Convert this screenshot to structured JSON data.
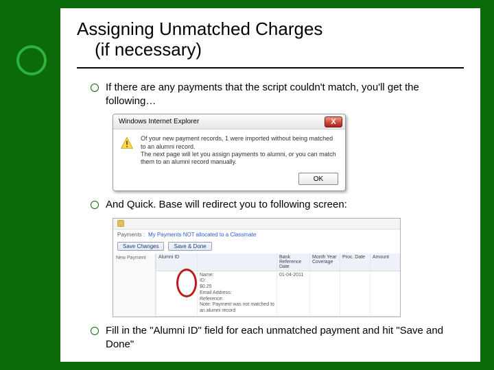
{
  "title_line1": "Assigning Unmatched Charges",
  "title_line2": "(if necessary)",
  "bullets": {
    "b1": "If there are any payments that the script couldn't match, you'll get the following…",
    "b2": "And Quick. Base will redirect you to following screen:",
    "b3": "Fill in the \"Alumni ID\" field for each unmatched payment and hit \"Save and Done\""
  },
  "dialog": {
    "title": "Windows Internet Explorer",
    "line1": "Of your new payment records, 1 were imported without being matched to an alumni record.",
    "line2": "The next page will let you assign payments to alumni, or you can match them to an alumni record manually.",
    "ok": "OK",
    "close": "X"
  },
  "qb": {
    "crumb_section": "Payments :",
    "crumb_report": "My Payments NOT allocated to a Classmate",
    "save_changes": "Save Changes",
    "save_done": "Save & Done",
    "left_label": "New Payment",
    "headers": {
      "alumni_id": "Alumni ID",
      "detail": "",
      "bank": "Bank Reference Date",
      "month": "Month Year Coverage",
      "proc": "Proc. Date",
      "amount": "Amount"
    },
    "row": {
      "alumni_id": "",
      "detail_name": "Name:",
      "detail_id": "ID:",
      "detail_amt": "$0.25",
      "detail_email": "Email Address:",
      "detail_note1": "Reference:",
      "detail_note2": "Note: Payment was not matched to an alumni record",
      "bank": "01-04-2011",
      "month": "",
      "proc": "",
      "amount": ""
    }
  }
}
